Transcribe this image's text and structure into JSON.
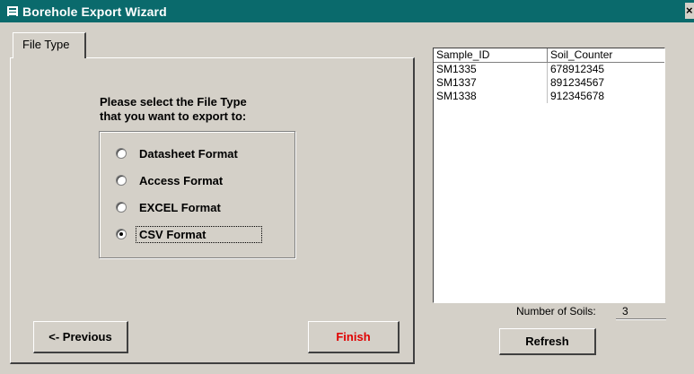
{
  "window": {
    "title": "Borehole Export Wizard",
    "close_glyph": "×"
  },
  "tabs": [
    {
      "label": "File Type"
    }
  ],
  "file_type": {
    "prompt_line1": "Please select the File Type",
    "prompt_line2": "that you want to export to:",
    "options": [
      {
        "label": "Datasheet Format",
        "checked": false
      },
      {
        "label": "Access Format",
        "checked": false
      },
      {
        "label": "EXCEL Format",
        "checked": false
      },
      {
        "label": "CSV Format",
        "checked": true
      }
    ]
  },
  "buttons": {
    "previous": "<- Previous",
    "finish": "Finish",
    "refresh": "Refresh"
  },
  "colors": {
    "titlebar": "#0a6a6c",
    "finish_text": "#e00000"
  },
  "soil_list": {
    "columns": [
      "Sample_ID",
      "Soil_Counter"
    ],
    "rows": [
      [
        "SM1335",
        "678912345"
      ],
      [
        "SM1337",
        "891234567"
      ],
      [
        "SM1338",
        "912345678"
      ]
    ]
  },
  "summary": {
    "count_label": "Number of Soils:",
    "count_value": "3"
  }
}
